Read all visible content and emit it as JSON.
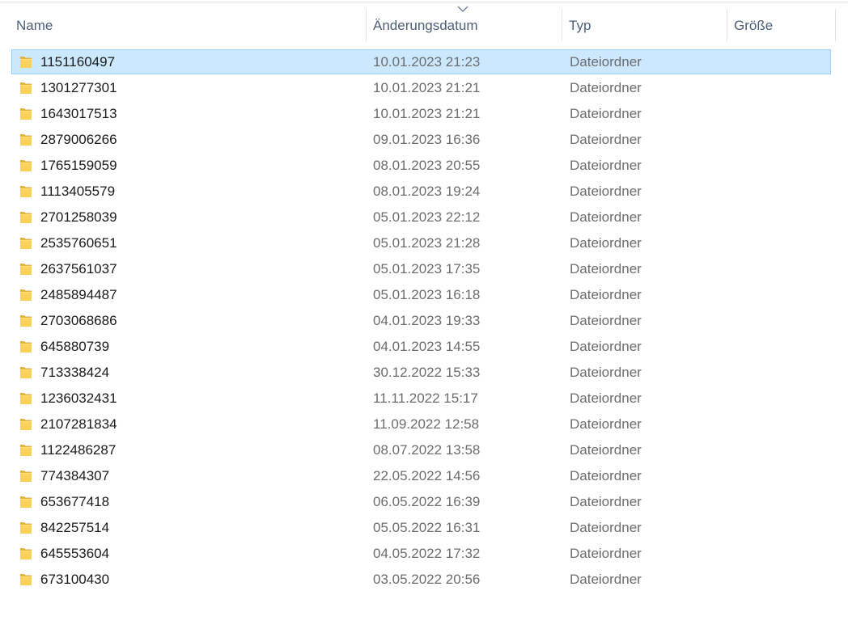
{
  "columns": {
    "name": "Name",
    "date": "Änderungsdatum",
    "type": "Typ",
    "size": "Größe"
  },
  "sort_indicator": "chevron-down-icon",
  "folder_icon": "folder-icon",
  "colors": {
    "selection_bg": "#cce8ff",
    "selection_border": "#99d1ff",
    "folder_yellow": "#ffd35b"
  },
  "selected_index": 0,
  "rows": [
    {
      "name": "1151160497",
      "date": "10.01.2023 21:23",
      "type": "Dateiordner"
    },
    {
      "name": "1301277301",
      "date": "10.01.2023 21:21",
      "type": "Dateiordner"
    },
    {
      "name": "1643017513",
      "date": "10.01.2023 21:21",
      "type": "Dateiordner"
    },
    {
      "name": "2879006266",
      "date": "09.01.2023 16:36",
      "type": "Dateiordner"
    },
    {
      "name": "1765159059",
      "date": "08.01.2023 20:55",
      "type": "Dateiordner"
    },
    {
      "name": "1113405579",
      "date": "08.01.2023 19:24",
      "type": "Dateiordner"
    },
    {
      "name": "2701258039",
      "date": "05.01.2023 22:12",
      "type": "Dateiordner"
    },
    {
      "name": "2535760651",
      "date": "05.01.2023 21:28",
      "type": "Dateiordner"
    },
    {
      "name": "2637561037",
      "date": "05.01.2023 17:35",
      "type": "Dateiordner"
    },
    {
      "name": "2485894487",
      "date": "05.01.2023 16:18",
      "type": "Dateiordner"
    },
    {
      "name": "2703068686",
      "date": "04.01.2023 19:33",
      "type": "Dateiordner"
    },
    {
      "name": "645880739",
      "date": "04.01.2023 14:55",
      "type": "Dateiordner"
    },
    {
      "name": "713338424",
      "date": "30.12.2022 15:33",
      "type": "Dateiordner"
    },
    {
      "name": "1236032431",
      "date": "11.11.2022 15:17",
      "type": "Dateiordner"
    },
    {
      "name": "2107281834",
      "date": "11.09.2022 12:58",
      "type": "Dateiordner"
    },
    {
      "name": "1122486287",
      "date": "08.07.2022 13:58",
      "type": "Dateiordner"
    },
    {
      "name": "774384307",
      "date": "22.05.2022 14:56",
      "type": "Dateiordner"
    },
    {
      "name": "653677418",
      "date": "06.05.2022 16:39",
      "type": "Dateiordner"
    },
    {
      "name": "842257514",
      "date": "05.05.2022 16:31",
      "type": "Dateiordner"
    },
    {
      "name": "645553604",
      "date": "04.05.2022 17:32",
      "type": "Dateiordner"
    },
    {
      "name": "673100430",
      "date": "03.05.2022 20:56",
      "type": "Dateiordner"
    }
  ]
}
